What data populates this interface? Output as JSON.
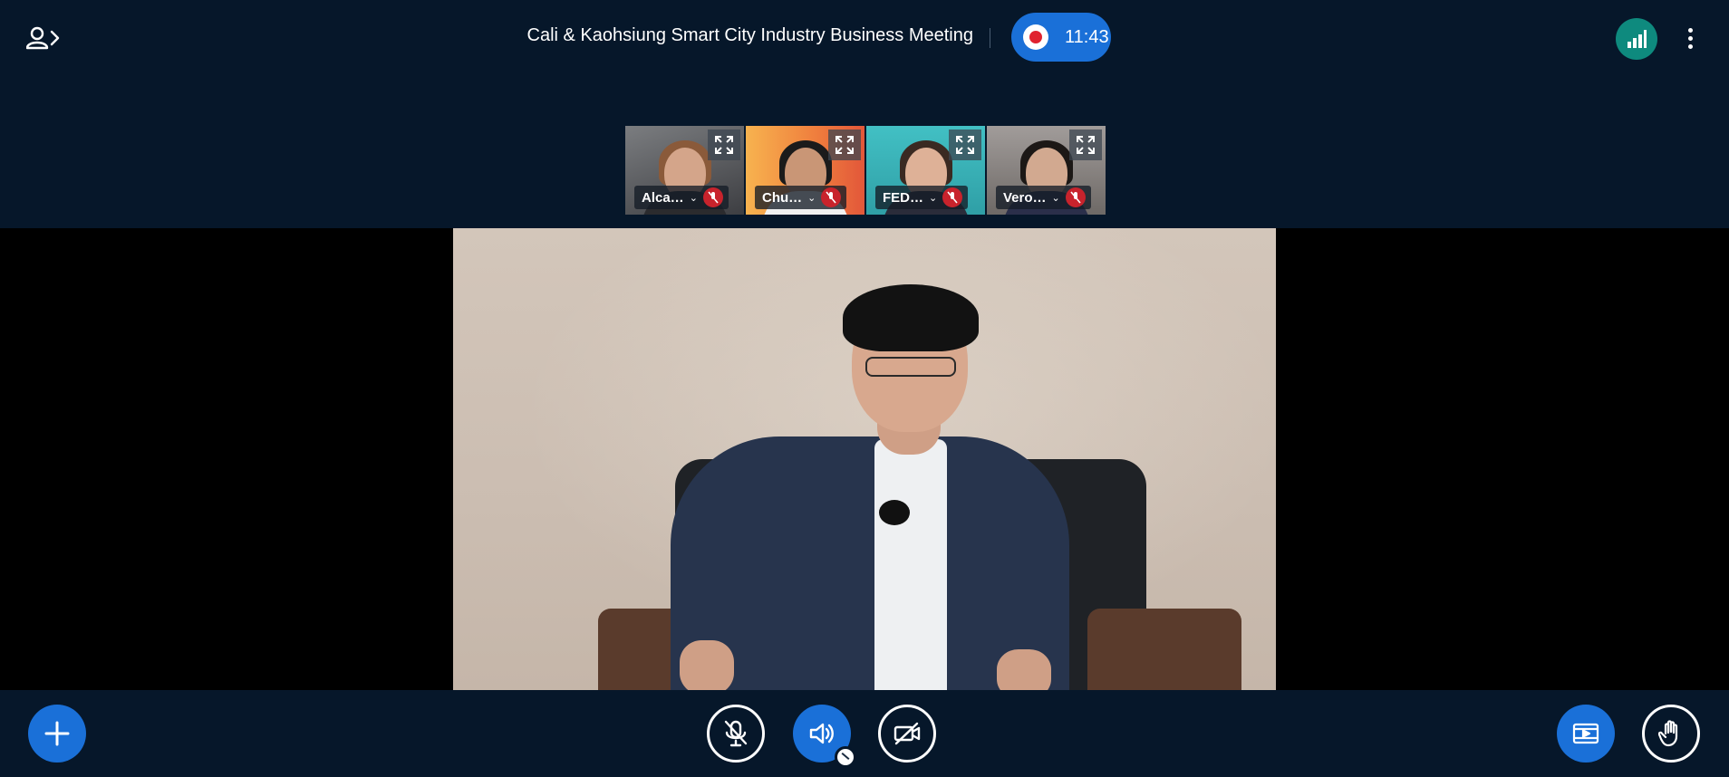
{
  "header": {
    "meeting_title": "Cali & Kaohsiung Smart City Industry Business Meeting",
    "recording_time": "11:43",
    "user_list_icon": "user-list-toggle-icon",
    "connection_icon": "signal-bars-icon",
    "more_icon": "more-vertical-icon"
  },
  "thumbnails": [
    {
      "name": "Alca…",
      "muted": true,
      "bg": "#5d5f63"
    },
    {
      "name": "Chu…",
      "muted": true,
      "bg": "#f1a24a"
    },
    {
      "name": "FED…",
      "muted": true,
      "bg": "#3bb3b8"
    },
    {
      "name": "Vero…",
      "muted": true,
      "bg": "#8f8a89"
    }
  ],
  "controls": {
    "actions_icon": "plus-icon",
    "mic_icon": "mic-muted-icon",
    "audio_icon": "speaker-icon",
    "camera_icon": "camera-off-icon",
    "presentation_icon": "presentation-icon",
    "raise_hand_icon": "hand-icon"
  },
  "colors": {
    "background": "#06172a",
    "accent_blue": "#1a70d8",
    "record_red": "#e0222f",
    "connection_green": "#0e8a7e",
    "mute_red": "#c8232c"
  }
}
